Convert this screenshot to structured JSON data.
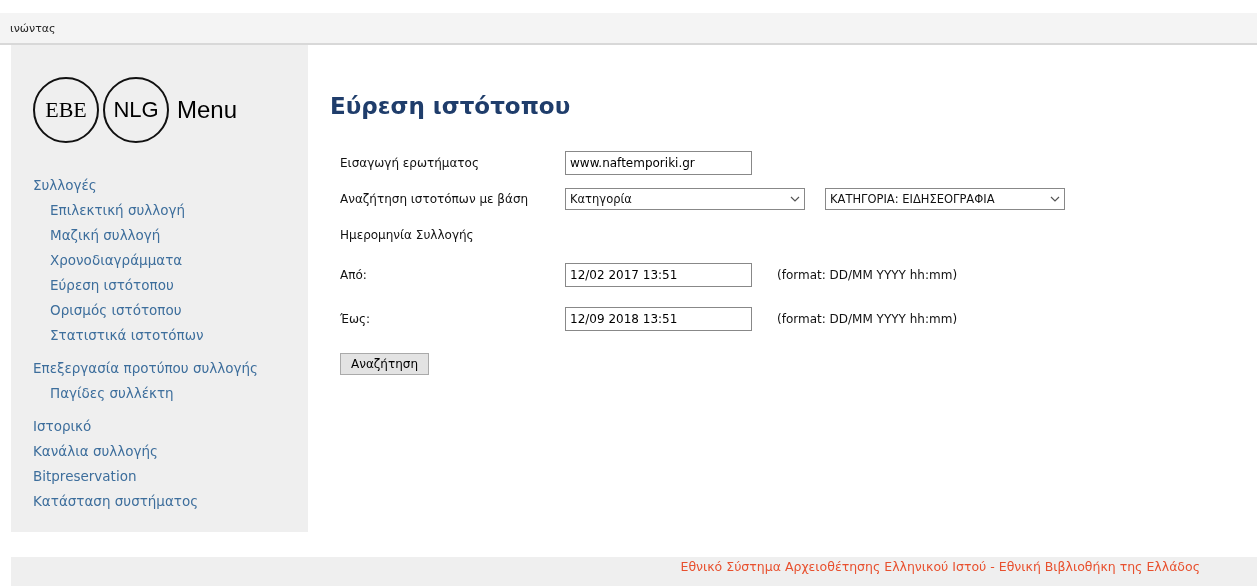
{
  "top_bar": {
    "text": "ινώντας"
  },
  "sidebar": {
    "logo": {
      "left": "EBE",
      "right": "NLG",
      "title": "Menu"
    },
    "items": [
      {
        "label": "Συλλογές",
        "children": [
          {
            "label": "Επιλεκτική συλλογή"
          },
          {
            "label": "Μαζική συλλογή"
          },
          {
            "label": "Χρονοδιαγράμματα"
          },
          {
            "label": "Εύρεση ιστότοπου"
          },
          {
            "label": "Ορισμός ιστότοπου"
          },
          {
            "label": "Στατιστικά ιστοτόπων"
          }
        ]
      },
      {
        "label": "Επεξεργασία προτύπου συλλογής",
        "children": [
          {
            "label": "Παγίδες συλλέκτη"
          }
        ]
      },
      {
        "label": "Ιστορικό"
      },
      {
        "label": "Κανάλια συλλογής"
      },
      {
        "label": "Bitpreservation"
      },
      {
        "label": "Κατάσταση συστήματος"
      }
    ]
  },
  "main": {
    "title": "Εύρεση ιστότοπου",
    "form": [
      {
        "kind": "input",
        "label": "Εισαγωγή ερωτήματος",
        "value": "www.naftemporiki.gr"
      },
      {
        "kind": "selects",
        "label": "Αναζήτηση ιστοτόπων με βάση",
        "values": [
          "Κατηγορία",
          "ΚΑΤΗΓΟΡΙΑ: ΕΙΔΗΣΕΟΓΡΑΦΙΑ"
        ]
      },
      {
        "kind": "heading",
        "label": "Ημερομηνία Συλλογής"
      },
      {
        "kind": "date",
        "label": "Από:",
        "value": "12/02 2017 13:51",
        "hint": "(format: DD/MM YYYY hh:mm)"
      },
      {
        "kind": "date",
        "label": "Έως:",
        "value": "12/09 2018 13:51",
        "hint": "(format: DD/MM YYYY hh:mm)"
      }
    ],
    "button": "Αναζήτηση"
  },
  "footer": {
    "text": "Εθνικό Σύστημα Αρχειοθέτησης Ελληνικού Ιστού - Εθνική Βιβλιοθήκη της Ελλάδος"
  }
}
